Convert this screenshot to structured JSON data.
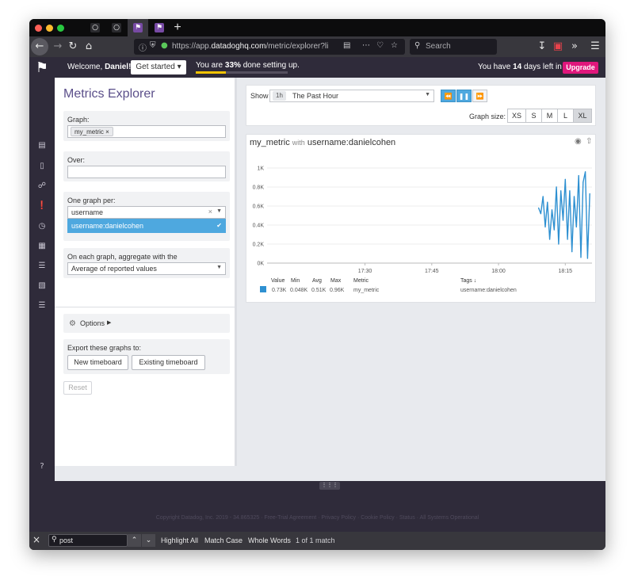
{
  "colors": {
    "accent_blue": "#4ea8df",
    "series_blue": "#2e90d1",
    "upgrade_pink": "#e0177c",
    "progress_yellow": "#f4c400",
    "title_purple": "#5b4f8a"
  },
  "browser": {
    "url_prefix": "https://app.",
    "url_domain": "datadoghq.com",
    "url_path": "/metric/explorer?li",
    "search_placeholder": "Search"
  },
  "topbar": {
    "welcome_prefix": "Welcome,",
    "welcome_name": "Daniel!",
    "get_started": "Get started ▾",
    "setup_prefix": "You are",
    "setup_percent": "33%",
    "setup_suffix": "done setting up.",
    "setup_progress": 0.33,
    "trial_prefix": "You have",
    "trial_days": "14",
    "trial_suffix": "days left in your trial.",
    "upgrade": "Upgrade"
  },
  "explorer": {
    "title": "Metrics Explorer",
    "graph_label": "Graph:",
    "graph_chip": "my_metric ×",
    "over_label": "Over:",
    "one_graph_label": "One graph per:",
    "one_graph_value": "username",
    "dropdown_option": "username:danielcohen",
    "aggregate_label": "On each graph, aggregate with the",
    "aggregate_value": "Average of reported values",
    "options_label": "Options",
    "export_label": "Export these graphs to:",
    "new_timeboard": "New timeboard",
    "existing_timeboard": "Existing timeboard",
    "reset": "Reset"
  },
  "controls": {
    "show_label": "Show",
    "time_badge": "1h",
    "time_text": "The Past Hour",
    "graph_size_label": "Graph size:",
    "sizes": [
      "XS",
      "S",
      "M",
      "L",
      "XL"
    ],
    "selected_size": "XL"
  },
  "graph": {
    "metric": "my_metric",
    "with_text": "with",
    "tag": "username:danielcohen",
    "legend": {
      "headers": [
        "Value",
        "Min",
        "Avg",
        "Max",
        "Metric",
        "Tags ↓"
      ],
      "values": [
        "0.73K",
        "0.048K",
        "0.51K",
        "0.96K",
        "my_metric",
        "username:danielcohen"
      ]
    }
  },
  "chart_data": {
    "type": "line",
    "ylim": [
      0,
      1000
    ],
    "y_ticks": [
      "0K",
      "0.2K",
      "0.4K",
      "0.6K",
      "0.8K",
      "1K"
    ],
    "x_ticks": [
      "17:30",
      "17:45",
      "18:00",
      "18:15"
    ],
    "xlim": [
      "17:08",
      "18:21"
    ],
    "series": [
      {
        "name": "my_metric",
        "x": [
          "18:09",
          "18:09.5",
          "18:10",
          "18:10.5",
          "18:11",
          "18:11.5",
          "18:12",
          "18:12.5",
          "18:13",
          "18:13.5",
          "18:14",
          "18:14.5",
          "18:15",
          "18:15.5",
          "18:16",
          "18:16.5",
          "18:17",
          "18:17.5",
          "18:18",
          "18:18.5",
          "18:19",
          "18:19.5",
          "18:20",
          "18:20.5"
        ],
        "values": [
          580,
          520,
          700,
          380,
          640,
          250,
          560,
          350,
          800,
          200,
          760,
          450,
          880,
          250,
          760,
          120,
          700,
          380,
          920,
          60,
          850,
          960,
          50,
          730
        ]
      }
    ]
  },
  "footer": {
    "text": "Copyright Datadog, Inc. 2019 - 34.865325 · Free-Trial Agreement · Privacy Policy · Cookie Policy · Status · All Systems Operational"
  },
  "findbar": {
    "query": "post",
    "highlight_all": "Highlight All",
    "match_case": "Match Case",
    "whole_words": "Whole Words",
    "result": "1 of 1 match"
  }
}
